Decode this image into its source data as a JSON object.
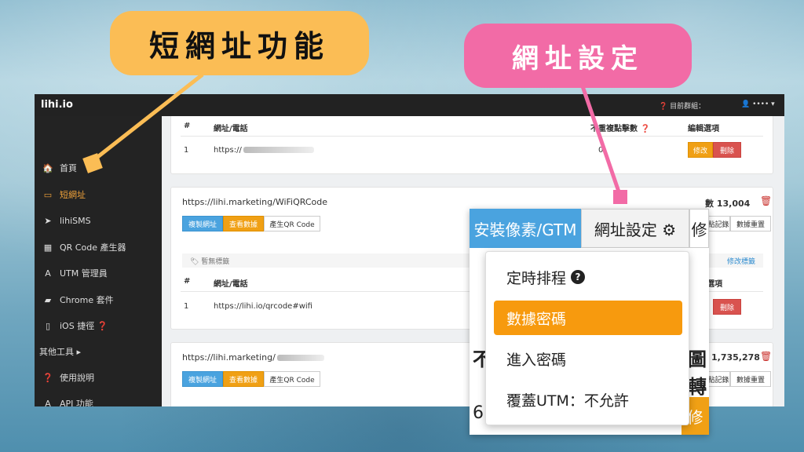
{
  "callouts": {
    "shorten": "短網址功能",
    "settings": "網址設定"
  },
  "topbar": {
    "brand": "lihi.io",
    "group_label": "❓ 目前群組：",
    "user_label": "👤 •••• ▾"
  },
  "sidebar": {
    "items": [
      {
        "icon": "🏠",
        "label": "首頁"
      },
      {
        "icon": "▭",
        "label": "短網址"
      },
      {
        "icon": "➤",
        "label": "lihiSMS"
      },
      {
        "icon": "▦",
        "label": "QR Code 產生器"
      },
      {
        "icon": "A",
        "label": "UTM 管理員"
      },
      {
        "icon": "▰",
        "label": "Chrome 套件"
      },
      {
        "icon": "▯",
        "label": "iOS 捷徑 ❓"
      },
      {
        "icon": "",
        "label": "其他工具 ▸"
      },
      {
        "icon": "❓",
        "label": "使用說明"
      },
      {
        "icon": "A",
        "label": "API 功能"
      }
    ]
  },
  "table": {
    "col_num": "#",
    "col_url": "網址/電話",
    "col_clicks": "不重複點擊數 ❓",
    "col_edit": "編輯選項",
    "col_edit_partial": "選項"
  },
  "card1": {
    "row_num": "1",
    "row_url": "https://",
    "clicks": "0",
    "edit": "修改",
    "delete": "刪除"
  },
  "card2": {
    "url": "https://lihi.marketing/WiFiQRCode",
    "copy": "複製網址",
    "stats": "查看數據",
    "qr": "產生QR Code",
    "clicks": "數 13,004",
    "records": "點記錄",
    "reset": "數據重置",
    "tag": "🏷 暫無標籤",
    "edit_tag": "修改標籤",
    "row_num": "1",
    "row_url": "https://lihi.io/qrcode#wifi",
    "delete": "刪除"
  },
  "card3": {
    "url": "https://lihi.marketing/",
    "copy": "複製網址",
    "stats": "查看數據",
    "qr": "產生QR Code",
    "clicks": "1,735,278",
    "records": "點記錄",
    "reset": "數據重置"
  },
  "zoom": {
    "tab_pixel": "安裝像素/GTM",
    "tab_settings": "網址設定 ⚙",
    "tab_edit": "修",
    "menu": [
      "定時排程",
      "數據密碼",
      "進入密碼",
      "覆蓋UTM：不允許"
    ],
    "partial_left": "不",
    "partial_right": "圖轉",
    "partial_bottom": "6",
    "partial_btn": "修"
  }
}
